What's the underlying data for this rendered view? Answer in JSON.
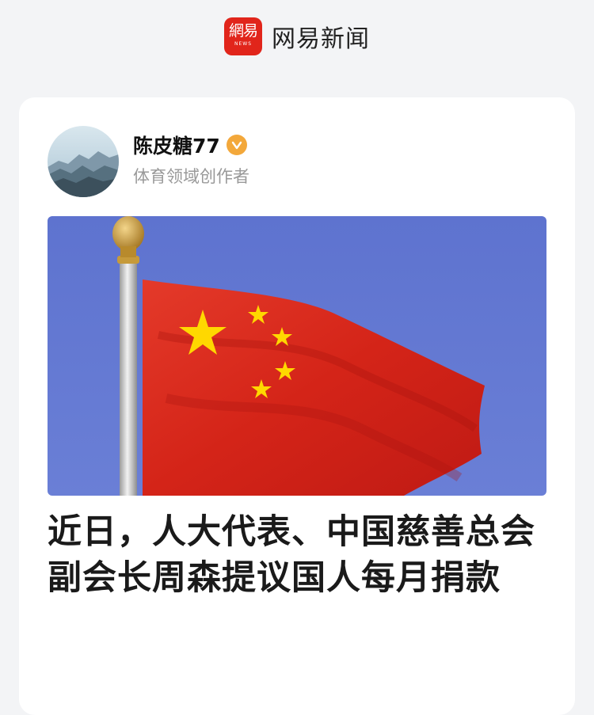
{
  "app": {
    "title": "网易新闻",
    "logo_text": "網易",
    "logo_subtext": "NEWS"
  },
  "author": {
    "name": "陈皮糖77",
    "subtitle": "体育领域创作者",
    "verified": true,
    "verified_color": "#f3a83b"
  },
  "article": {
    "headline": "近日，人大代表、中国慈善总会副会长周森提议国人每月捐款"
  },
  "colors": {
    "brand_red": "#e1251b",
    "background": "#f3f4f6",
    "card": "#ffffff"
  },
  "icons": {
    "verified": "check-badge-icon",
    "logo": "netease-news-logo"
  }
}
